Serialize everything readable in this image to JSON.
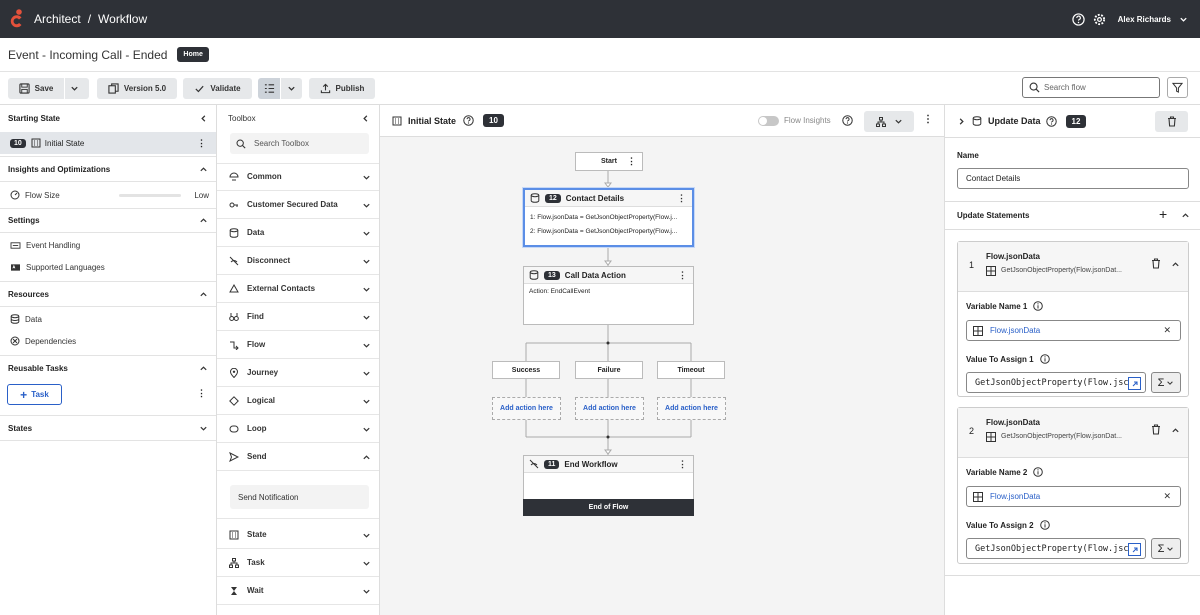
{
  "app": {
    "name": "Architect",
    "section": "Workflow",
    "user": "Alex Richards"
  },
  "flow": {
    "title": "Event - Incoming Call - Ended",
    "badge": "Home"
  },
  "toolbar": {
    "save": "Save",
    "version": "Version 5.0",
    "validate": "Validate",
    "publish": "Publish",
    "search_placeholder": "Search flow"
  },
  "left": {
    "starting_state": "Starting State",
    "initial_badge": "10",
    "initial_label": "Initial State",
    "insights": "Insights and Optimizations",
    "flow_size": "Flow Size",
    "flow_size_value": "Low",
    "flow_size_level": 0.0,
    "settings": "Settings",
    "event_handling": "Event Handling",
    "supported_languages": "Supported Languages",
    "resources": "Resources",
    "data": "Data",
    "dependencies": "Dependencies",
    "reusable_tasks": "Reusable Tasks",
    "task_button": "Task",
    "states": "States"
  },
  "toolbox": {
    "title": "Toolbox",
    "search_placeholder": "Search Toolbox",
    "items": [
      "Common",
      "Customer Secured Data",
      "Data",
      "Disconnect",
      "External Contacts",
      "Find",
      "Flow",
      "Journey",
      "Logical",
      "Loop",
      "Send",
      "State",
      "Task",
      "Wait"
    ],
    "send_child": "Send Notification"
  },
  "canvas": {
    "state_title": "Initial State",
    "state_badge": "10",
    "flow_insights": "Flow Insights",
    "start": "Start",
    "contact": {
      "badge": "12",
      "title": "Contact Details",
      "line1": "1: Flow.jsonData = GetJsonObjectProperty(Flow.j...",
      "line2": "2: Flow.jsonData = GetJsonObjectProperty(Flow.j..."
    },
    "calldata": {
      "badge": "13",
      "title": "Call Data Action",
      "line1": "Action: EndCallEvent"
    },
    "branches": [
      "Success",
      "Failure",
      "Timeout"
    ],
    "add_action": "Add action here",
    "end": {
      "badge": "11",
      "title": "End Workflow",
      "footer": "End of Flow"
    }
  },
  "right": {
    "title": "Update Data",
    "badge": "12",
    "name_label": "Name",
    "name_value": "Contact Details",
    "update_statements": "Update Statements",
    "statements": [
      {
        "num": "1",
        "title": "Flow.jsonData",
        "sub": "GetJsonObjectProperty(Flow.jsonDat...",
        "var_label": "Variable Name 1",
        "var_value": "Flow.jsonData",
        "assign_label": "Value To Assign 1",
        "assign_value": "GetJsonObjectProperty(Flow.jsc"
      },
      {
        "num": "2",
        "title": "Flow.jsonData",
        "sub": "GetJsonObjectProperty(Flow.jsonDat...",
        "var_label": "Variable Name 2",
        "var_value": "Flow.jsonData",
        "assign_label": "Value To Assign 2",
        "assign_value": "GetJsonObjectProperty(Flow.jsc"
      }
    ]
  },
  "colors": {
    "topbar": "#2e3137",
    "accent": "#e4513b",
    "link": "#2a60c8",
    "selected": "#5b8ee6"
  }
}
